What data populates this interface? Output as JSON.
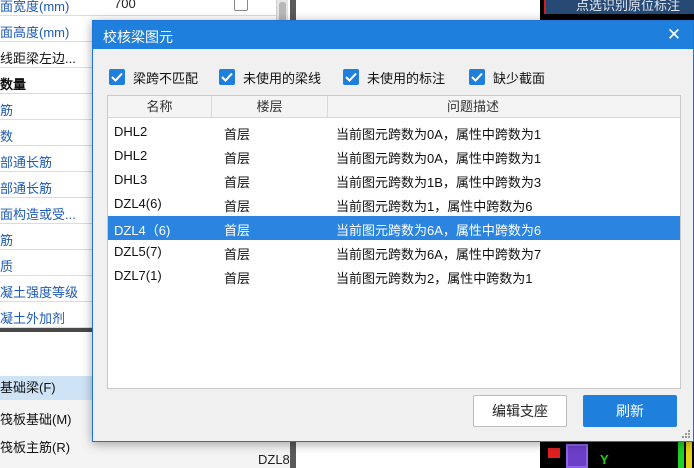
{
  "property_panel": {
    "rows": [
      {
        "name": "面宽度(mm)",
        "value": "700",
        "checkbox": true
      },
      {
        "name": "面高度(mm)",
        "value": "",
        "checkbox": false
      },
      {
        "name": "线距梁左边...",
        "value": "",
        "checkbox": false
      },
      {
        "name": "数量",
        "value": "",
        "checkbox": false
      },
      {
        "name": "筋",
        "value": "",
        "checkbox": false
      },
      {
        "name": "数",
        "value": "",
        "checkbox": false
      },
      {
        "name": "部通长筋",
        "value": "",
        "checkbox": false
      },
      {
        "name": "部通长筋",
        "value": "",
        "checkbox": false
      },
      {
        "name": "面构造或受...",
        "value": "",
        "checkbox": false
      },
      {
        "name": "筋",
        "value": "",
        "checkbox": false
      },
      {
        "name": "质",
        "value": "",
        "checkbox": false
      },
      {
        "name": "凝土强度等级",
        "value": "",
        "checkbox": false
      },
      {
        "name": "凝土外加剂",
        "value": "",
        "checkbox": false
      }
    ]
  },
  "bottom_list": {
    "items": [
      "基础梁(F)",
      "筏板基础(M)",
      "筏板主筋(R)"
    ]
  },
  "mid_stray_text": "DZL8",
  "canvas": {
    "banner": "点选识别原位标注",
    "axis_label": "Y"
  },
  "dialog": {
    "title": "校核梁图元",
    "close_glyph": "✕",
    "filters": [
      {
        "label": "梁跨不匹配",
        "checked": true
      },
      {
        "label": "未使用的梁线",
        "checked": true
      },
      {
        "label": "未使用的标注",
        "checked": true
      },
      {
        "label": "缺少截面",
        "checked": true
      }
    ],
    "columns": [
      "名称",
      "楼层",
      "问题描述"
    ],
    "rows": [
      {
        "name": "DHL2",
        "floor": "首层",
        "desc": "当前图元跨数为0A，属性中跨数为1"
      },
      {
        "name": "DHL2",
        "floor": "首层",
        "desc": "当前图元跨数为0A，属性中跨数为1"
      },
      {
        "name": "DHL3",
        "floor": "首层",
        "desc": "当前图元跨数为1B，属性中跨数为3"
      },
      {
        "name": "DZL4(6)",
        "floor": "首层",
        "desc": "当前图元跨数为1，属性中跨数为6"
      },
      {
        "name": "DZL4（6)",
        "floor": "首层",
        "desc": "当前图元跨数为6A，属性中跨数为6"
      },
      {
        "name": "DZL5(7)",
        "floor": "首层",
        "desc": "当前图元跨数为6A，属性中跨数为7"
      },
      {
        "name": "DZL7(1)",
        "floor": "首层",
        "desc": "当前图元跨数为2，属性中跨数为1"
      }
    ],
    "selected_row": 4,
    "buttons": {
      "edit": "编辑支座",
      "refresh": "刷新"
    }
  },
  "colors": {
    "accent": "#1e7fdc",
    "selected_row": "#2b84e0",
    "link_text": "#1f5bb5"
  }
}
